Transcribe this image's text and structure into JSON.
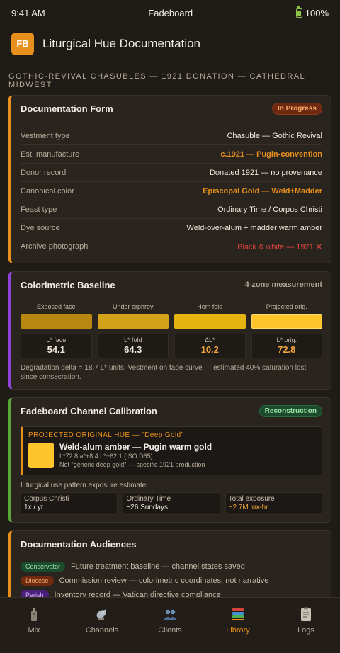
{
  "status": {
    "time": "9:41 AM",
    "carrier": "Fadeboard",
    "battery": "100%"
  },
  "header": {
    "logo": "FB",
    "title": "Liturgical Hue Documentation"
  },
  "context": "GOTHIC-REVIVAL CHASUBLES — 1921 DONATION — CATHEDRAL MIDWEST",
  "form": {
    "title": "Documentation Form",
    "badge": "In Progress",
    "rows": [
      {
        "label": "Vestment type",
        "value": "Chasuble — Gothic Revival"
      },
      {
        "label": "Est. manufacture",
        "value": "c.1921 — Pugin-convention"
      },
      {
        "label": "Donor record",
        "value": "Donated 1921 — no provenance"
      },
      {
        "label": "Canonical color",
        "value": "Episcopal Gold — Weld+Madder"
      },
      {
        "label": "Feast type",
        "value": "Ordinary Time / Corpus Christi"
      },
      {
        "label": "Dye source",
        "value": "Weld-over-alum + madder warm amber"
      },
      {
        "label": "Archive photograph",
        "value": "Black & white — 1921 ✕"
      }
    ]
  },
  "baseline": {
    "title": "Colorimetric Baseline",
    "meta": "4-zone measurement",
    "zones": [
      {
        "label": "Exposed face",
        "color": "#b8870f"
      },
      {
        "label": "Under orphrey",
        "color": "#d4a11a"
      },
      {
        "label": "Hem fold",
        "color": "#e6b410"
      },
      {
        "label": "Projected orig.",
        "color": "#ffc52a"
      }
    ],
    "stats": [
      {
        "label": "L* face",
        "value": "54.1"
      },
      {
        "label": "L* fold",
        "value": "64.3"
      },
      {
        "label": "ΔL*",
        "value": "10.2"
      },
      {
        "label": "L* orig.",
        "value": "72.8"
      }
    ],
    "note": "Degradation delta = 18.7 L* units. Vestment on fade curve — estimated 40% saturation lost since consecration."
  },
  "calibration": {
    "title": "Fadeboard Channel Calibration",
    "badge": "Reconstruction",
    "projected_label": "PROJECTED ORIGINAL HUE — \"Deep Gold\"",
    "hue_name": "Weld-alum amber — Pugin warm gold",
    "hue_coords": "L*72.8 a*+8.4 b*+62.1 (ISO D65)",
    "hue_note": "Not \"generic deep gold\" — specific 1921 production",
    "swatch_color": "#ffc52a",
    "exposure_label": "Liturgical use pattern exposure estimate:",
    "exposures": [
      {
        "label": "Corpus Christi",
        "value": "1x / yr"
      },
      {
        "label": "Ordinary Time",
        "value": "~26 Sundays"
      },
      {
        "label": "Total exposure",
        "value": "~2.7M lux-hr"
      }
    ]
  },
  "audiences": {
    "title": "Documentation Audiences",
    "items": [
      {
        "tag": "Conservator",
        "text": "Future treatment baseline — channel states saved"
      },
      {
        "tag": "Diocese",
        "text": "Commission review — colorimetric coordinates, not narrative"
      },
      {
        "tag": "Parish",
        "text": "Inventory record — Vatican directive compliance"
      }
    ]
  },
  "tabs": [
    {
      "label": "Mix",
      "icon": "candle-icon"
    },
    {
      "label": "Channels",
      "icon": "satellite-dish-icon"
    },
    {
      "label": "Clients",
      "icon": "people-icon"
    },
    {
      "label": "Library",
      "icon": "books-icon"
    },
    {
      "label": "Logs",
      "icon": "clipboard-icon"
    }
  ],
  "accent_color": "#e8901d"
}
